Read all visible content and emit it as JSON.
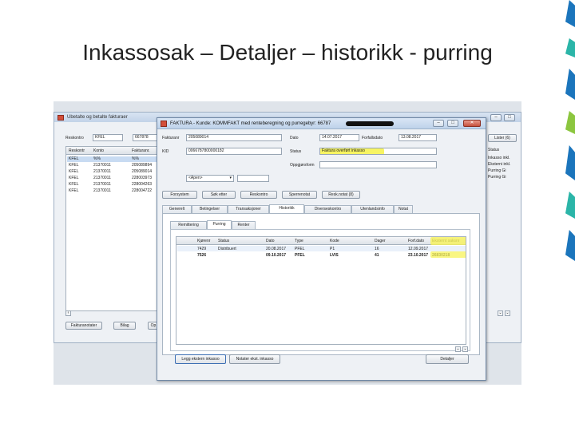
{
  "slide": {
    "title": "Inkassosak – Detaljer – historikk - purring"
  },
  "decoration": {
    "colors": [
      "#1b75bc",
      "#2bb5a8",
      "#1b75bc",
      "#8cc63f",
      "#1b75bc",
      "#2bb5a8",
      "#1b75bc"
    ]
  },
  "back_window": {
    "title": "Ubetalte og betalte fakturaer",
    "reskontro_label": "Reskontro",
    "reskontro_value": "KFEL",
    "kunde_value": "667878",
    "columns": [
      "Reskontr",
      "Konto",
      "Fakturanr."
    ],
    "filter_row": [
      "KFEL",
      "%%",
      "%%"
    ],
    "rows": [
      [
        "KFEL",
        "21370011",
        "205089894"
      ],
      [
        "KFEL",
        "21370011",
        "205089014"
      ],
      [
        "KFEL",
        "21370011",
        "228003973"
      ],
      [
        "KFEL",
        "21370011",
        "228004263"
      ],
      [
        "KFEL",
        "21370011",
        "228004722"
      ]
    ],
    "right_header": "Status",
    "right_buttons": [
      "Lister (6)"
    ],
    "right_statuses": [
      "Inkasso inkl.",
      "Eksterni inkl.",
      "Purring Gi",
      "Purring Gi"
    ],
    "bottom_buttons": [
      "Fakturanotater",
      "Bilag",
      "Op"
    ]
  },
  "front_window": {
    "title": "FAKTURA - Kunde: KOMMFAKT med renteberegning og purregebyr: 66787",
    "fields": {
      "fakturanr_label": "Fakturanr",
      "fakturanr_value": "205089014",
      "dato_label": "Dato",
      "dato_value": "14.07.2017",
      "forfallsdato_label": "Forfallsdato",
      "forfallsdato_value": "13.08.2017",
      "kid_label": "KID",
      "kid_value": "0066787800000182",
      "status_label": "Status",
      "status_value": "Faktura overført inkasso",
      "oppgjorsform_label": "Oppgjørsform",
      "apen_value": "<Åpen>"
    },
    "action_buttons": [
      "Forsystem",
      "Søk etter",
      "Reskontro",
      "Sperrenotat",
      "Resk.notat (8)"
    ],
    "tabs": [
      "Generelt",
      "Betingelser",
      "Transaksjoner",
      "Historikk",
      "Diverseskontro",
      "Utenlandsinfo",
      "Notat"
    ],
    "active_tab": "Historikk",
    "subtabs": [
      "Remittering",
      "Purring",
      "Renter"
    ],
    "active_subtab": "Purring",
    "table": {
      "columns": [
        "Kjørenr",
        "Status",
        "Dato",
        "Type",
        "Kode",
        "Dager",
        "Forf.dato",
        "Eksternt saksnr"
      ],
      "rows": [
        [
          "7429",
          "Distribuert",
          "20.08.2017",
          "PFEL",
          "P1",
          "16",
          "12.09.2017",
          ""
        ],
        [
          "7526",
          "",
          "09.10.2017",
          "PFEL",
          "LVIS",
          "41",
          "23.10.2017",
          "26830218"
        ]
      ]
    },
    "bottom_buttons": {
      "legg": "Legg ekstern inkasso",
      "notater": "Notater ekst. inkasso",
      "detaljer": "Detaljer"
    },
    "highlight_color": "#f7f35a"
  }
}
